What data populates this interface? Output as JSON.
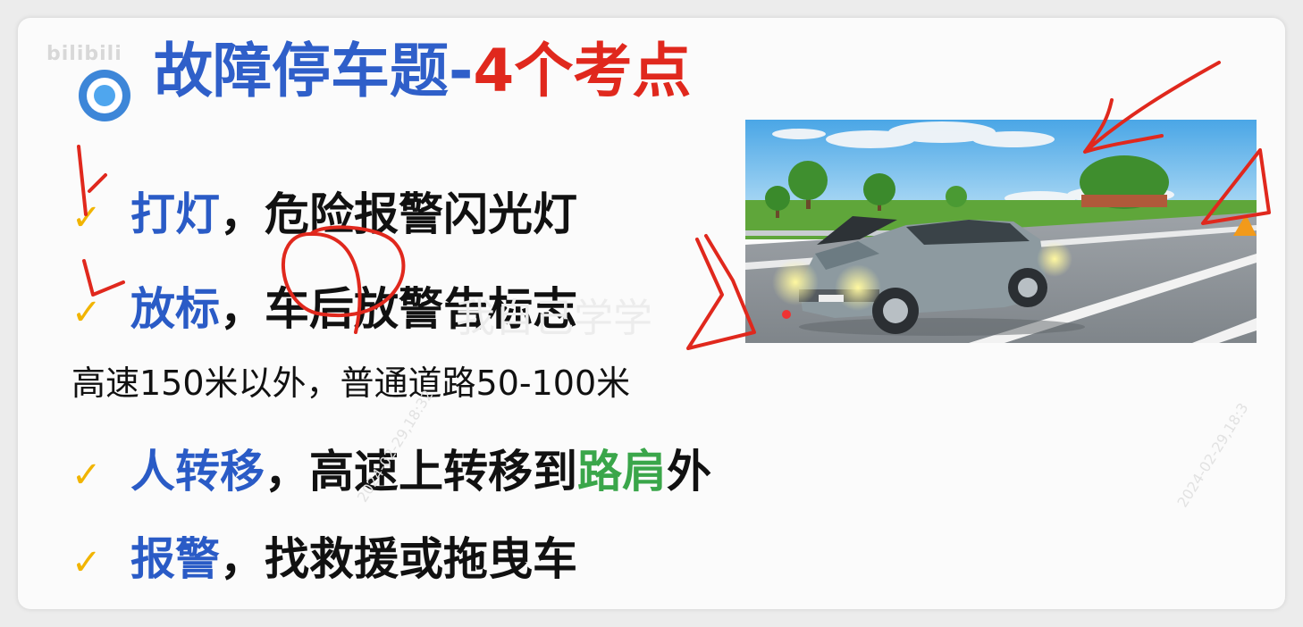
{
  "watermark": {
    "logo": "bilibili",
    "date_1": "2024-02-29,18:32",
    "date_2": "2024-02-29,18:3",
    "faint_text": "我自己学学"
  },
  "title": {
    "part1": "故障停车题-",
    "part2": "4个考点"
  },
  "items": [
    {
      "check": "✓",
      "keyword": "打灯",
      "sep": "，",
      "rest": "危险报警闪光灯"
    },
    {
      "check": "✓",
      "keyword": "放标",
      "sep": "，",
      "rest": "车后放警告标志"
    },
    {
      "check": "✓",
      "keyword": "人转移",
      "sep": "，",
      "rest_a": "高速上转移到",
      "highlight": "路肩",
      "rest_b": "外"
    },
    {
      "check": "✓",
      "keyword": "报警",
      "sep": "，",
      "rest": "找救援或拖曳车"
    }
  ],
  "subnote": "高速150米以外，普通道路50-100米",
  "image": {
    "icon": "broken-down-car-illustration"
  },
  "colors": {
    "blue": "#2f5fc9",
    "red": "#e0281d",
    "green": "#3aa64a",
    "check": "#f1b400",
    "ink": "#e0281d"
  }
}
